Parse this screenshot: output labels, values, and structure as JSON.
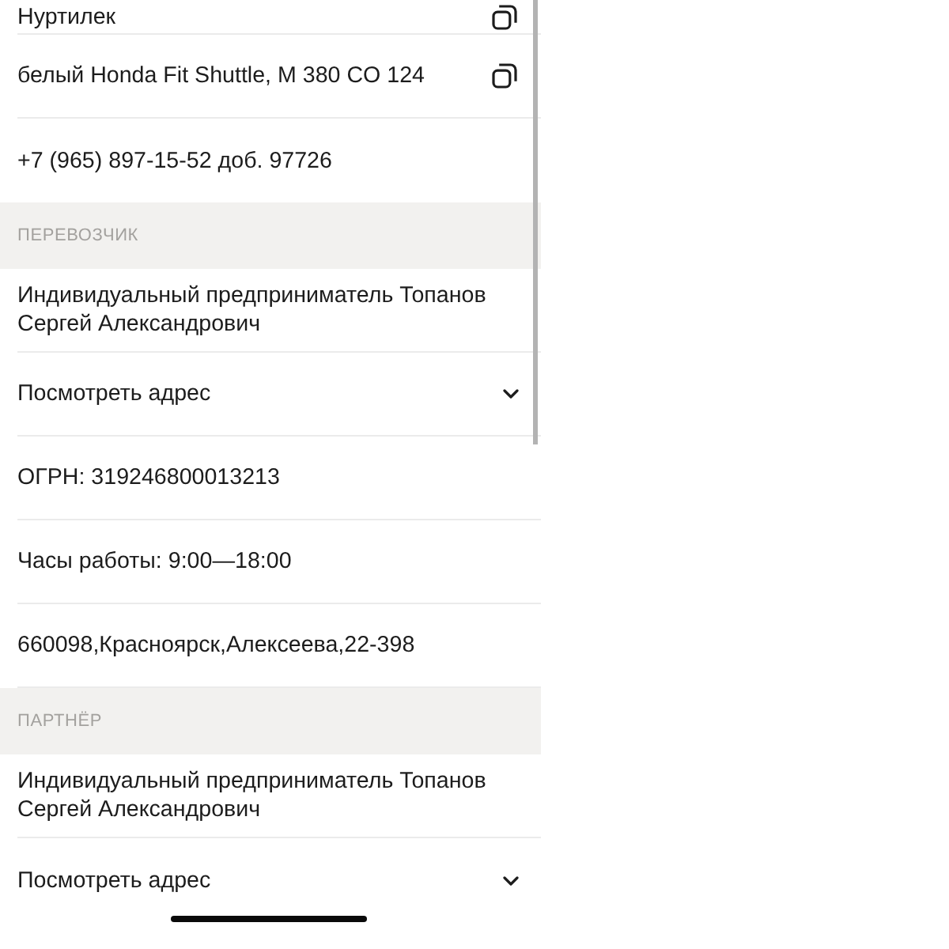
{
  "top_rows": [
    {
      "kind": "copy",
      "text": "Нуртилек"
    },
    {
      "kind": "copy",
      "text": "белый Honda Fit Shuttle, M 380 CO 124"
    },
    {
      "kind": "text",
      "text": "+7 (965) 897-15-52 доб. 97726"
    }
  ],
  "sections": [
    {
      "title": "ПЕРЕВОЗЧИК",
      "rows": [
        {
          "kind": "text",
          "text": "Индивидуальный предприниматель Топанов Сергей Александрович"
        },
        {
          "kind": "expander",
          "text": "Посмотреть адрес",
          "expanded": false
        },
        {
          "kind": "text",
          "text": "ОГРН: 319246800013213"
        },
        {
          "kind": "text",
          "text": "Часы работы: 9:00—18:00"
        },
        {
          "kind": "text",
          "text": "660098,Красноярск,Алексеева,22-398"
        }
      ]
    },
    {
      "title": "ПАРТНЁР",
      "rows": [
        {
          "kind": "text",
          "text": "Индивидуальный предприниматель Топанов Сергей Александрович"
        },
        {
          "kind": "expander",
          "text": "Посмотреть адрес",
          "expanded": false
        }
      ]
    }
  ]
}
